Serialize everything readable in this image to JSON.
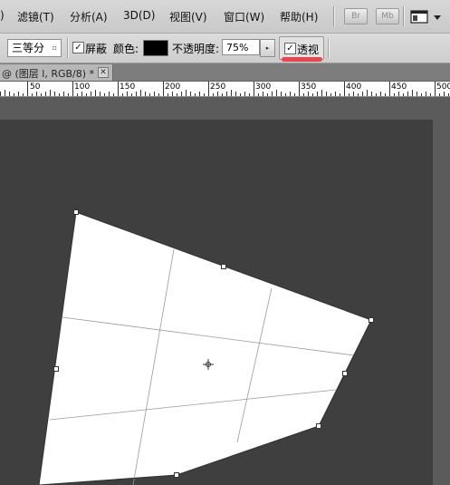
{
  "menu": {
    "items": [
      {
        "label": ")"
      },
      {
        "label": "滤镜(T)"
      },
      {
        "label": "分析(A)"
      },
      {
        "label": "3D(D)"
      },
      {
        "label": "视图(V)"
      },
      {
        "label": "窗口(W)"
      },
      {
        "label": "帮助(H)"
      }
    ],
    "bridge_label": "Br",
    "minibridge_label": "Mb",
    "screen_mode_icon": "screen-mode-icon"
  },
  "options": {
    "grid_select_value": "三等分",
    "hide_label": "屏蔽",
    "hide_checked": true,
    "color_label": "颜色:",
    "color_value": "#000000",
    "opacity_label": "不透明度:",
    "opacity_value": "75%",
    "perspective_label": "透视",
    "perspective_checked": true
  },
  "document": {
    "tab_label": "@ (图层 l, RGB/8) *"
  },
  "ruler": {
    "labels": [
      "50",
      "100",
      "150",
      "200",
      "250",
      "300",
      "350",
      "400",
      "450",
      "500"
    ]
  },
  "colors": {
    "canvas": "#3f3f3f",
    "pasteboard": "#5b5b5b",
    "highlight_mark": "#e8464d"
  }
}
